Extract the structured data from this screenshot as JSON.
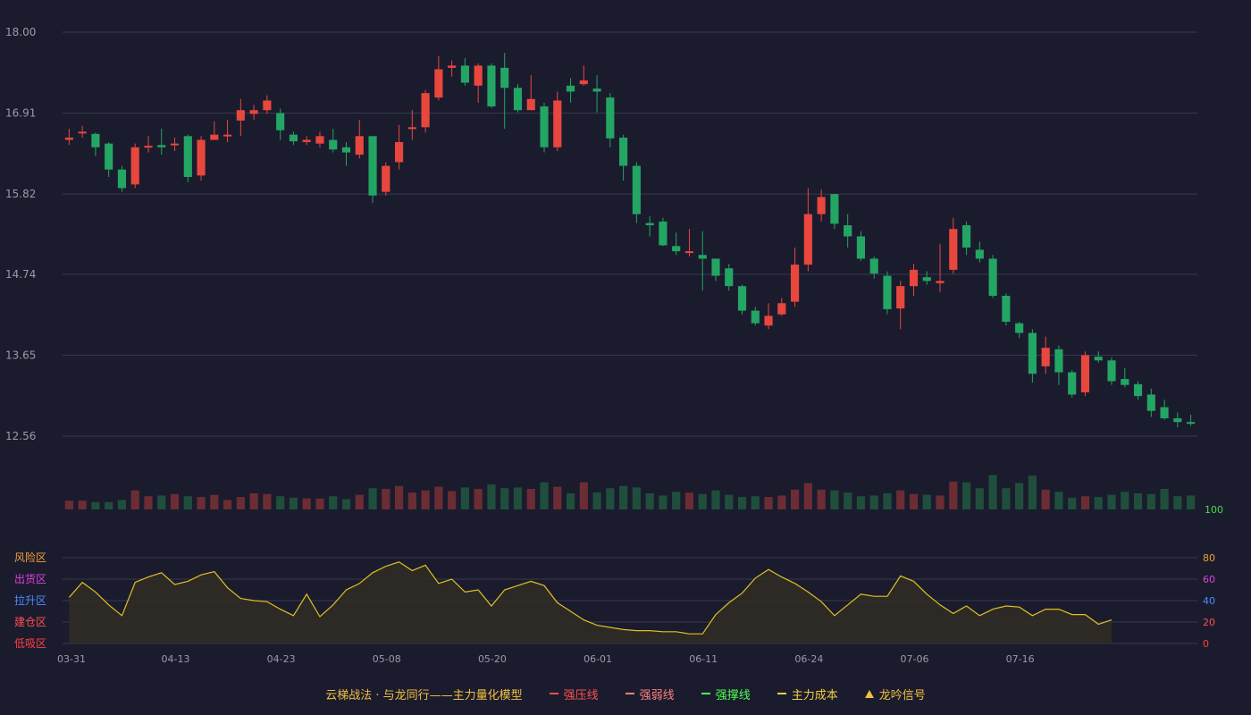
{
  "chart_data": {
    "type": "candlestick",
    "price_axis": {
      "ticks": [
        "18.00",
        "16.91",
        "15.82",
        "14.74",
        "13.65",
        "12.56"
      ],
      "min": 12.56,
      "max": 18.0
    },
    "volume_axis": {
      "max_label": "100"
    },
    "x_axis": {
      "labels": [
        {
          "label": "03-31",
          "index": 0
        },
        {
          "label": "04-13",
          "index": 8
        },
        {
          "label": "04-23",
          "index": 16
        },
        {
          "label": "05-08",
          "index": 24
        },
        {
          "label": "05-20",
          "index": 32
        },
        {
          "label": "06-01",
          "index": 40
        },
        {
          "label": "06-11",
          "index": 48
        },
        {
          "label": "06-24",
          "index": 56
        },
        {
          "label": "07-06",
          "index": 64
        },
        {
          "label": "07-16",
          "index": 72
        }
      ]
    },
    "candles": [
      [
        16.55,
        16.58,
        16.48,
        16.7,
        12
      ],
      [
        16.64,
        16.66,
        16.58,
        16.74,
        12
      ],
      [
        16.63,
        16.45,
        16.33,
        16.65,
        10
      ],
      [
        16.5,
        16.15,
        16.05,
        16.52,
        10
      ],
      [
        16.15,
        15.9,
        15.85,
        16.2,
        13
      ],
      [
        15.95,
        16.45,
        15.9,
        16.5,
        26
      ],
      [
        16.45,
        16.47,
        16.38,
        16.6,
        18
      ],
      [
        16.48,
        16.45,
        16.35,
        16.7,
        19
      ],
      [
        16.5,
        16.5,
        16.4,
        16.58,
        21
      ],
      [
        16.6,
        16.05,
        15.98,
        16.62,
        18
      ],
      [
        16.07,
        16.55,
        16.0,
        16.6,
        17
      ],
      [
        16.55,
        16.62,
        16.58,
        16.8,
        20
      ],
      [
        16.6,
        16.62,
        16.52,
        16.82,
        13
      ],
      [
        16.81,
        16.95,
        16.6,
        17.1,
        17
      ],
      [
        16.9,
        16.95,
        16.82,
        17.02,
        22
      ],
      [
        16.95,
        17.08,
        16.9,
        17.15,
        21
      ],
      [
        16.91,
        16.68,
        16.55,
        16.97,
        18
      ],
      [
        16.62,
        16.53,
        16.48,
        16.66,
        16
      ],
      [
        16.52,
        16.55,
        16.48,
        16.6,
        15
      ],
      [
        16.5,
        16.6,
        16.45,
        16.66,
        15
      ],
      [
        16.55,
        16.42,
        16.38,
        16.7,
        18
      ],
      [
        16.45,
        16.38,
        16.2,
        16.52,
        14
      ],
      [
        16.35,
        16.6,
        16.3,
        16.82,
        20
      ],
      [
        16.6,
        15.8,
        15.7,
        16.6,
        29
      ],
      [
        15.85,
        16.2,
        15.8,
        16.25,
        28
      ],
      [
        16.25,
        16.52,
        16.15,
        16.75,
        32
      ],
      [
        16.7,
        16.72,
        16.55,
        16.95,
        23
      ],
      [
        16.72,
        17.18,
        16.65,
        17.22,
        26
      ],
      [
        17.12,
        17.5,
        17.08,
        17.68,
        31
      ],
      [
        17.52,
        17.55,
        17.4,
        17.62,
        25
      ],
      [
        17.55,
        17.32,
        17.28,
        17.65,
        30
      ],
      [
        17.28,
        17.55,
        17.05,
        17.58,
        28
      ],
      [
        17.55,
        17.0,
        16.98,
        17.58,
        34
      ],
      [
        17.52,
        17.25,
        16.7,
        17.72,
        29
      ],
      [
        17.25,
        16.95,
        16.92,
        17.3,
        30
      ],
      [
        16.95,
        17.1,
        16.95,
        17.42,
        28
      ],
      [
        17.0,
        16.45,
        16.38,
        17.05,
        37
      ],
      [
        16.45,
        17.08,
        16.4,
        17.2,
        31
      ],
      [
        17.28,
        17.2,
        17.05,
        17.38,
        22
      ],
      [
        17.3,
        17.35,
        17.28,
        17.55,
        37
      ],
      [
        17.24,
        17.2,
        16.92,
        17.42,
        23
      ],
      [
        17.12,
        16.57,
        16.45,
        17.18,
        29
      ],
      [
        16.58,
        16.2,
        16.0,
        16.62,
        32
      ],
      [
        16.2,
        15.55,
        15.43,
        16.25,
        30
      ],
      [
        15.43,
        15.4,
        15.25,
        15.52,
        22
      ],
      [
        15.45,
        15.13,
        15.12,
        15.5,
        19
      ],
      [
        15.12,
        15.05,
        15.0,
        15.3,
        24
      ],
      [
        15.05,
        15.05,
        14.98,
        15.35,
        23
      ],
      [
        15.0,
        14.95,
        14.52,
        15.32,
        21
      ],
      [
        14.95,
        14.72,
        14.65,
        14.8,
        26
      ],
      [
        14.82,
        14.58,
        14.52,
        14.88,
        20
      ],
      [
        14.58,
        14.25,
        14.2,
        14.6,
        17
      ],
      [
        14.25,
        14.08,
        14.05,
        14.3,
        18
      ],
      [
        14.05,
        14.18,
        14.0,
        14.35,
        17
      ],
      [
        14.2,
        14.35,
        14.18,
        14.42,
        19
      ],
      [
        14.37,
        14.87,
        14.3,
        15.1,
        27
      ],
      [
        14.87,
        15.55,
        14.78,
        15.9,
        36
      ],
      [
        15.55,
        15.78,
        15.45,
        15.88,
        27
      ],
      [
        15.82,
        15.42,
        15.35,
        15.82,
        26
      ],
      [
        15.4,
        15.25,
        15.1,
        15.55,
        23
      ],
      [
        15.25,
        14.95,
        14.92,
        15.32,
        18
      ],
      [
        14.95,
        14.75,
        14.68,
        14.98,
        19
      ],
      [
        14.72,
        14.27,
        14.2,
        14.78,
        22
      ],
      [
        14.28,
        14.58,
        14.0,
        14.65,
        26
      ],
      [
        14.58,
        14.8,
        14.45,
        14.88,
        21
      ],
      [
        14.7,
        14.65,
        14.6,
        14.78,
        20
      ],
      [
        14.62,
        14.65,
        14.5,
        15.15,
        19
      ],
      [
        14.8,
        15.35,
        14.75,
        15.5,
        38
      ],
      [
        15.4,
        15.1,
        15.0,
        15.45,
        37
      ],
      [
        15.07,
        14.95,
        14.9,
        15.18,
        29
      ],
      [
        14.95,
        14.45,
        14.42,
        15.0,
        47
      ],
      [
        14.45,
        14.1,
        14.05,
        14.48,
        29
      ],
      [
        14.08,
        13.95,
        13.88,
        14.1,
        36
      ],
      [
        13.95,
        13.4,
        13.28,
        14.0,
        46
      ],
      [
        13.5,
        13.75,
        13.4,
        13.9,
        27
      ],
      [
        13.73,
        13.42,
        13.25,
        13.78,
        24
      ],
      [
        13.42,
        13.12,
        13.08,
        13.45,
        16
      ],
      [
        13.15,
        13.65,
        13.1,
        13.7,
        18
      ],
      [
        13.63,
        13.58,
        13.55,
        13.7,
        17
      ],
      [
        13.58,
        13.3,
        13.25,
        13.62,
        20
      ],
      [
        13.33,
        13.25,
        13.22,
        13.48,
        24
      ],
      [
        13.26,
        13.1,
        13.05,
        13.3,
        22
      ],
      [
        13.12,
        12.9,
        12.82,
        13.2,
        21
      ],
      [
        12.95,
        12.8,
        12.78,
        13.05,
        28
      ],
      [
        12.8,
        12.75,
        12.68,
        12.88,
        18
      ],
      [
        12.75,
        12.73,
        12.7,
        12.85,
        19
      ]
    ],
    "indicator": {
      "zones": [
        {
          "label": "风险区",
          "color": "#f0a030"
        },
        {
          "label": "出货区",
          "color": "#e040e0"
        },
        {
          "label": "拉升区",
          "color": "#4a8cff"
        },
        {
          "label": "建仓区",
          "color": "#ff5050"
        },
        {
          "label": "低吸区",
          "color": "#ff4040"
        }
      ],
      "ticks": [
        {
          "label": "80",
          "color": "#f0a030"
        },
        {
          "label": "60",
          "color": "#e040e0"
        },
        {
          "label": "40",
          "color": "#4a8cff"
        },
        {
          "label": "20",
          "color": "#ff5050"
        },
        {
          "label": "0",
          "color": "#ff4040"
        }
      ],
      "values": [
        43,
        57,
        48,
        36,
        26,
        57,
        62,
        66,
        55,
        58,
        64,
        67,
        52,
        42,
        40,
        39,
        32,
        26,
        46,
        25,
        36,
        50,
        56,
        66,
        72,
        76,
        68,
        73,
        56,
        60,
        48,
        50,
        35,
        50,
        54,
        58,
        54,
        38,
        30,
        22,
        17,
        15,
        13,
        12,
        12,
        11,
        11,
        9,
        9,
        27,
        38,
        47,
        61,
        69,
        62,
        56,
        48,
        39,
        26,
        36,
        46,
        44,
        44,
        63,
        58,
        46,
        36,
        28,
        35,
        26,
        32,
        35,
        34,
        26,
        32,
        32,
        27,
        27,
        18,
        22
      ]
    }
  },
  "legend": {
    "title": "云梯战法 · 与龙同行——主力量化模型",
    "items": [
      {
        "label": "强压线",
        "color": "#ff5050",
        "style": "solid"
      },
      {
        "label": "强弱线",
        "color": "#ff8080",
        "style": "dash"
      },
      {
        "label": "强撑线",
        "color": "#50ff50",
        "style": "solid"
      },
      {
        "label": "主力成本",
        "color": "#f0d040",
        "style": "dash"
      },
      {
        "label": "龙吟信号",
        "color": "#f0c040",
        "style": "triangle"
      }
    ]
  },
  "colors": {
    "up": "#e8473e",
    "down": "#23a564",
    "up_volume": "#6b2d33",
    "down_volume": "#1f4f3c",
    "grid": "#3a3a4e",
    "axis_text": "#9a9aaa",
    "indicator_line": "#e0c020",
    "indicator_fill": "#302c26",
    "volume_max_text": "#40e040"
  }
}
